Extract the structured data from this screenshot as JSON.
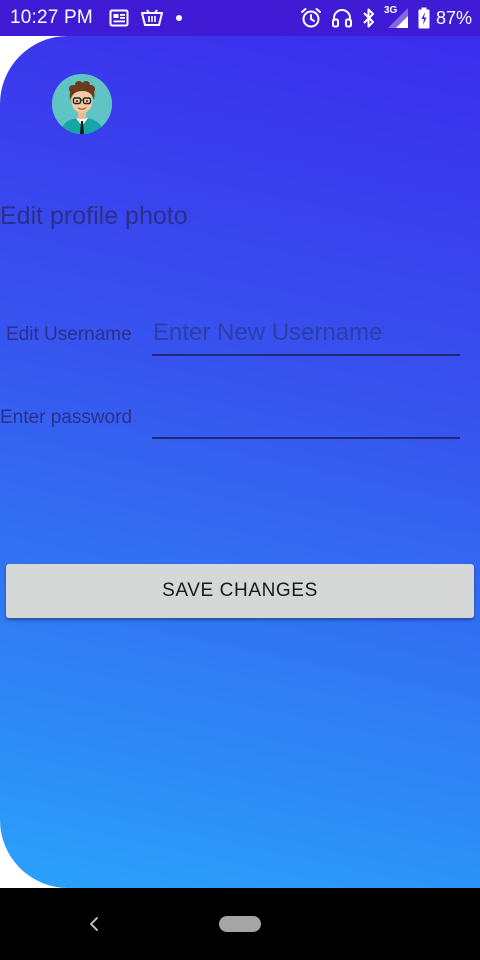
{
  "status_bar": {
    "time": "10:27 PM",
    "notification_icons": [
      "newspaper-icon",
      "basket-icon",
      "dot-icon"
    ],
    "system_icons": [
      "alarm-icon",
      "headset-icon",
      "bluetooth-icon",
      "signal-3g-icon",
      "battery-icon"
    ],
    "network_type": "3G",
    "battery_percent": "87%"
  },
  "profile": {
    "avatar_icon": "avatar-icon",
    "edit_photo_label": "Edit profile photo",
    "username_label": "Edit Username",
    "username_placeholder": "Enter New Username",
    "username_value": "",
    "password_label": "Enter password",
    "password_value": "",
    "save_button_label": "SAVE CHANGES"
  },
  "nav_bar": {
    "icons": [
      "back-icon",
      "home-pill-icon"
    ]
  },
  "colors": {
    "status_bar": "#3f1bd6",
    "gradient_top": "#3b2ded",
    "gradient_bottom": "#2aa2fb",
    "label_text": "#2b2f8c",
    "button_bg": "#d6d7d7"
  }
}
